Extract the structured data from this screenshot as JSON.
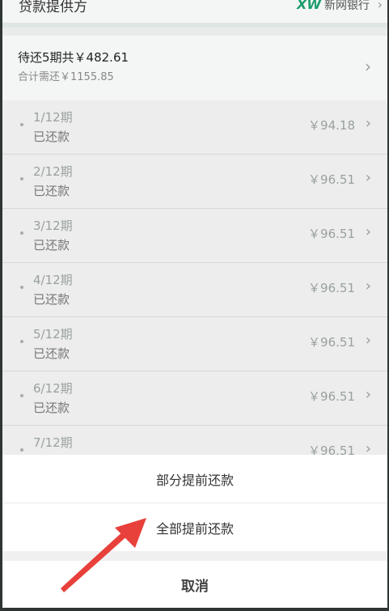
{
  "provider": {
    "label": "贷款提供方",
    "logo": "XW",
    "name": "新网银行"
  },
  "summary": {
    "main": "待还5期共￥482.61",
    "sub": "合计需还￥1155.85"
  },
  "installments": [
    {
      "period": "1/12期",
      "status": "已还款",
      "amount": "￥94.18"
    },
    {
      "period": "2/12期",
      "status": "已还款",
      "amount": "￥96.51"
    },
    {
      "period": "3/12期",
      "status": "已还款",
      "amount": "￥96.51"
    },
    {
      "period": "4/12期",
      "status": "已还款",
      "amount": "￥96.51"
    },
    {
      "period": "5/12期",
      "status": "已还款",
      "amount": "￥96.51"
    },
    {
      "period": "6/12期",
      "status": "已还款",
      "amount": "￥96.51"
    },
    {
      "period": "7/12期",
      "status": "",
      "amount": "￥96.51"
    }
  ],
  "sheet": {
    "partial_label": "部分提前还款",
    "full_label": "全部提前还款",
    "cancel_label": "取消"
  },
  "icons": {
    "chevron": "chevron-right-icon",
    "annotation": "red-arrow-icon"
  },
  "colors": {
    "logo_green": "#1a9d6d",
    "annotation_red": "#e8403a"
  }
}
